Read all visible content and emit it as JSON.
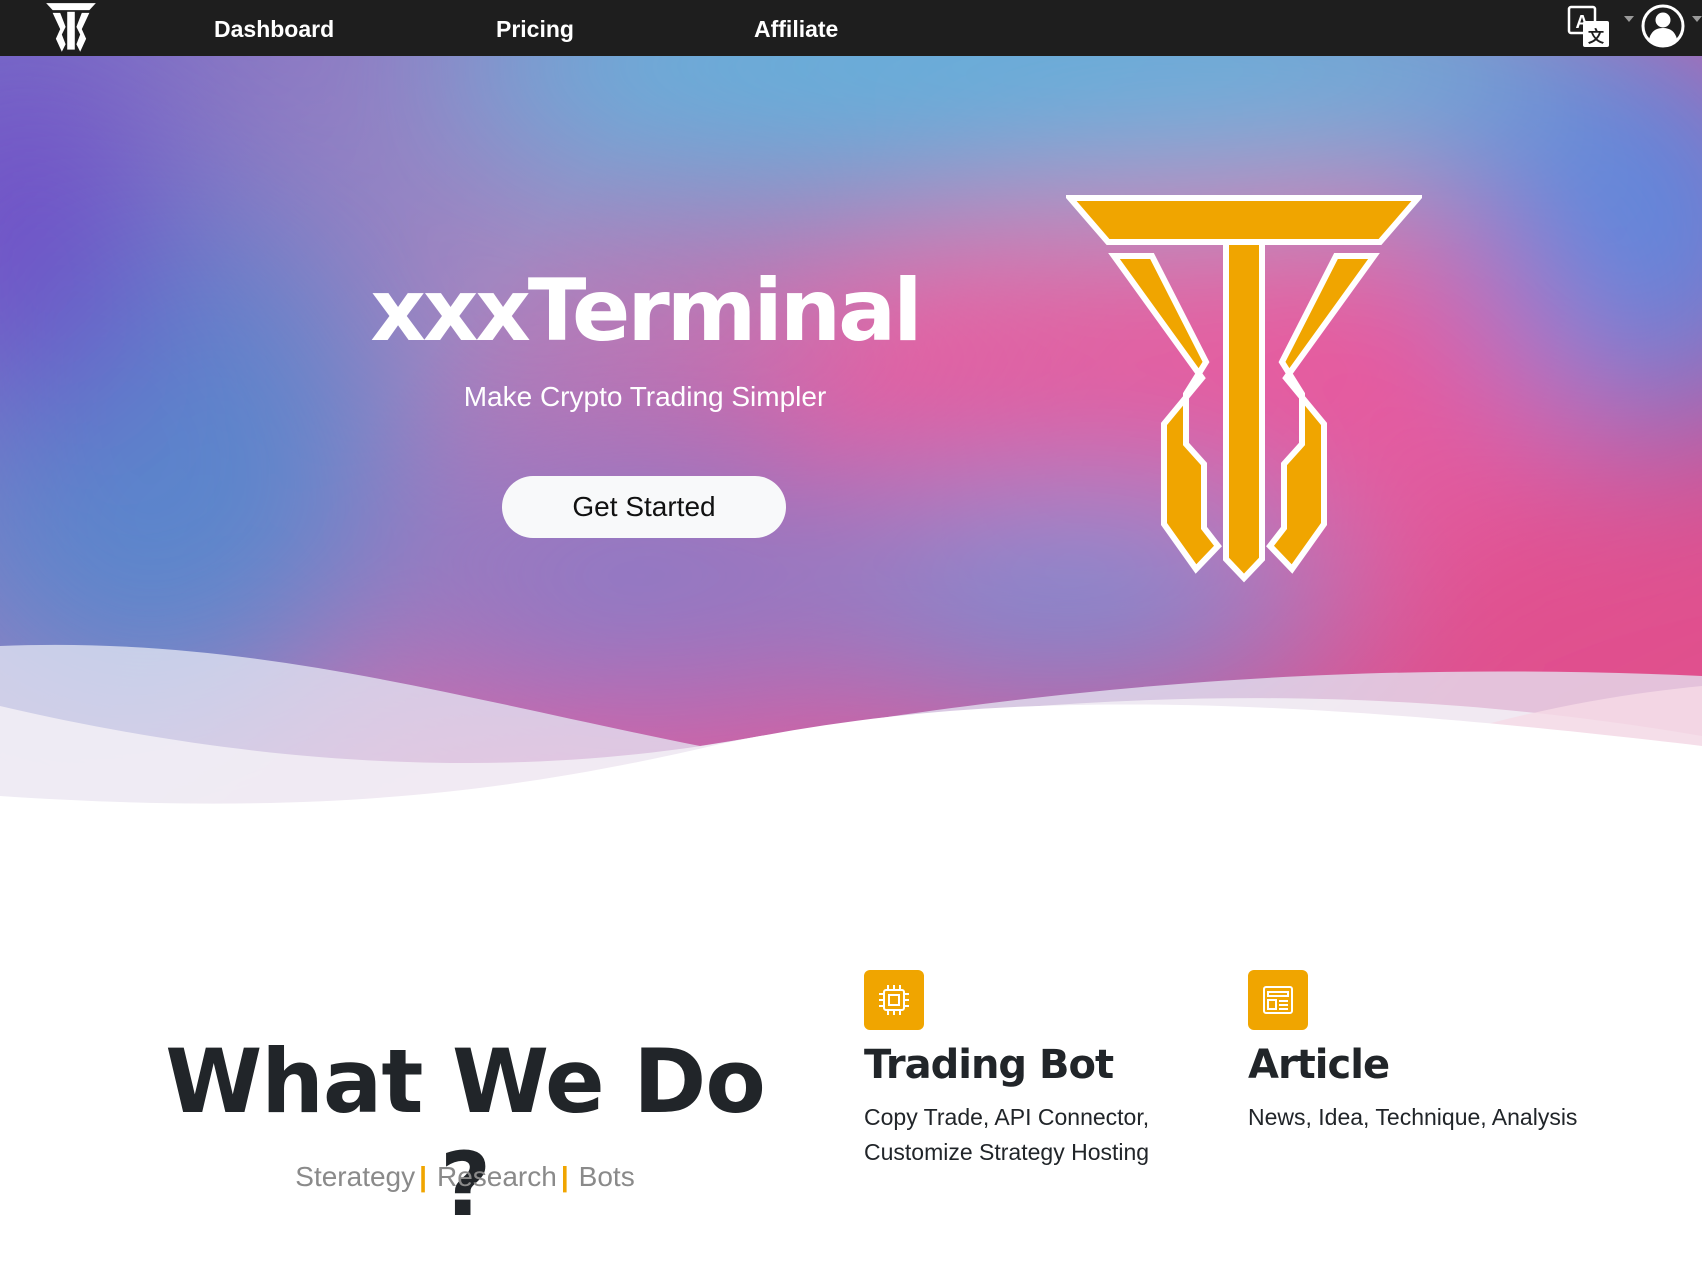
{
  "nav": {
    "logo_icon": "brand-logo-icon",
    "links": [
      "Dashboard",
      "Pricing",
      "Affiliate"
    ],
    "language_icon": "translate-icon",
    "user_icon": "user-account-icon"
  },
  "hero": {
    "title": "xxxTerminal",
    "subtitle": "Make Crypto Trading Simpler",
    "cta_label": "Get Started",
    "logo_icon": "brand-logo-icon",
    "logo_color": "#f0a500"
  },
  "what_we_do": {
    "heading": "What We Do ?",
    "tags": [
      "Sterategy",
      "Research",
      "Bots"
    ],
    "accent_color": "#f0a500",
    "services": [
      {
        "icon": "cpu-chip-icon",
        "title": "Trading Bot",
        "desc_lines": [
          "Copy Trade, API Connector,",
          "Customize Strategy Hosting"
        ]
      },
      {
        "icon": "newspaper-icon",
        "title": "Article",
        "desc_lines": [
          "News, Idea, Technique, Analysis"
        ]
      }
    ]
  }
}
